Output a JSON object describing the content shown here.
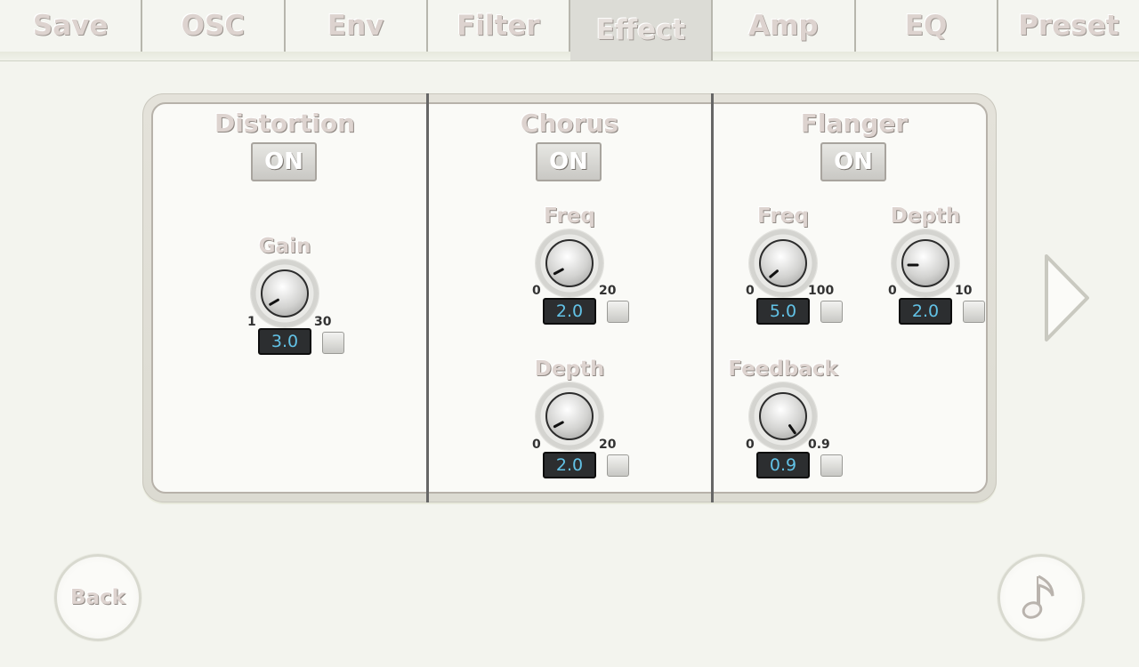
{
  "tabs": [
    {
      "label": "Save"
    },
    {
      "label": "OSC"
    },
    {
      "label": "Env"
    },
    {
      "label": "Filter"
    },
    {
      "label": "Effect"
    },
    {
      "label": "Amp"
    },
    {
      "label": "EQ"
    },
    {
      "label": "Preset"
    }
  ],
  "active_tab": "Effect",
  "distortion": {
    "title": "Distortion",
    "toggle": "ON",
    "gain": {
      "label": "Gain",
      "min": "1",
      "max": "30",
      "value": "3.0"
    }
  },
  "chorus": {
    "title": "Chorus",
    "toggle": "ON",
    "freq": {
      "label": "Freq",
      "min": "0",
      "max": "20",
      "value": "2.0"
    },
    "depth": {
      "label": "Depth",
      "min": "0",
      "max": "20",
      "value": "2.0"
    }
  },
  "flanger": {
    "title": "Flanger",
    "toggle": "ON",
    "freq": {
      "label": "Freq",
      "min": "0",
      "max": "100",
      "value": "5.0"
    },
    "depth": {
      "label": "Depth",
      "min": "0",
      "max": "10",
      "value": "2.0"
    },
    "feedback": {
      "label": "Feedback",
      "min": "0",
      "max": "0.9",
      "value": "0.9"
    }
  },
  "nav": {
    "back_label": "Back",
    "next_icon": "chevron-right-icon",
    "music_icon": "music-note-icon"
  }
}
